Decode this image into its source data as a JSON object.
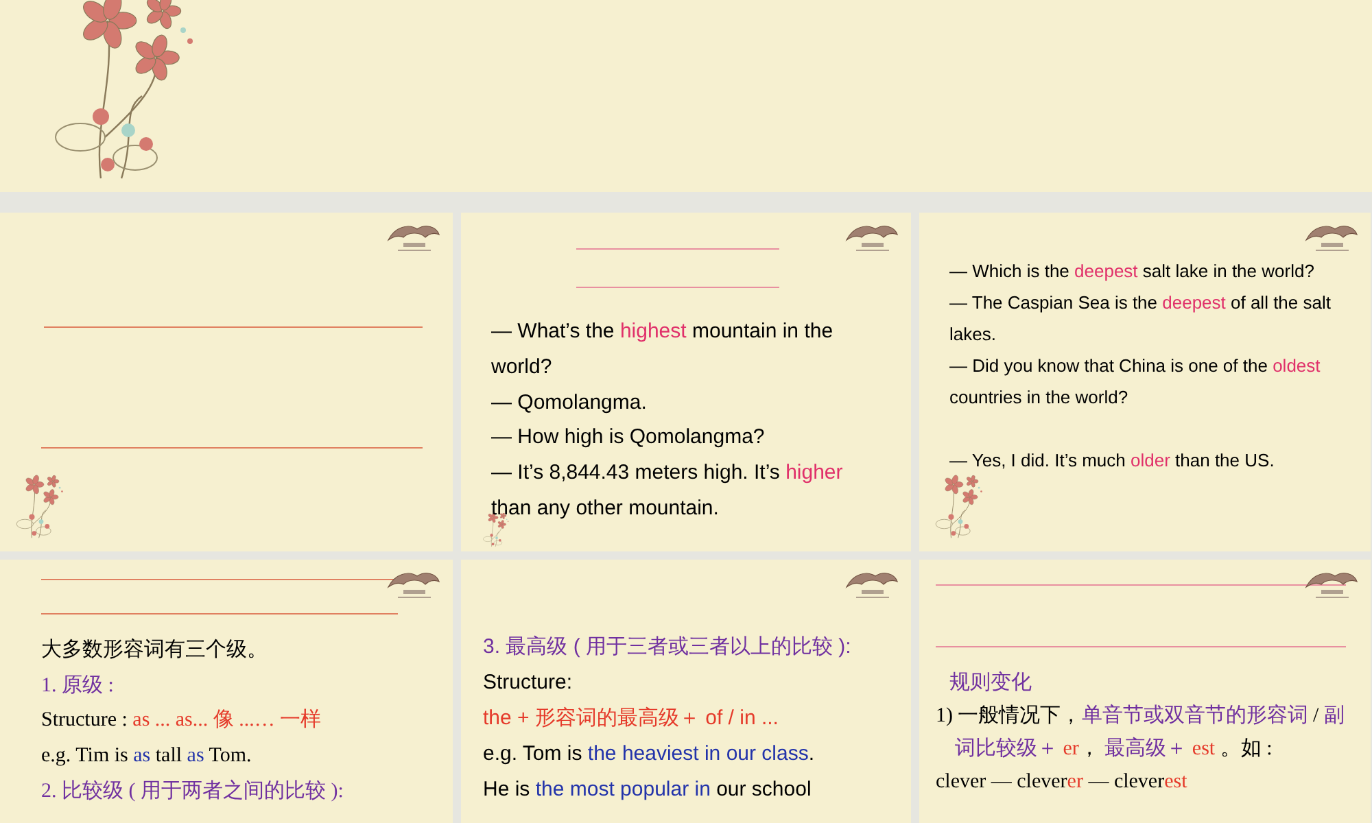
{
  "slides": [
    {
      "items": [
        {
          "kind": "rule",
          "color": "#e08060"
        },
        {
          "kind": "rule",
          "color": "#e08060"
        }
      ]
    },
    {
      "items": [
        {
          "kind": "rule",
          "color": "#e890a0"
        },
        {
          "kind": "rule",
          "color": "#e890a0"
        },
        {
          "kind": "text",
          "parts": [
            {
              "t": "— What’s the "
            },
            {
              "t": "highest",
              "color": "#e0306a"
            },
            {
              "t": " mountain in the world?"
            }
          ]
        },
        {
          "kind": "text",
          "parts": [
            {
              "t": "— Qomolangma."
            }
          ]
        },
        {
          "kind": "text",
          "parts": [
            {
              "t": "— How high is Qomolangma?"
            }
          ]
        },
        {
          "kind": "text",
          "parts": [
            {
              "t": "— It’s 8,844.43 meters high. It’s "
            },
            {
              "t": "higher",
              "color": "#e0306a"
            },
            {
              "t": " than any other mountain."
            }
          ]
        }
      ]
    },
    {
      "items": [
        {
          "kind": "text",
          "parts": [
            {
              "t": "— Which is the "
            },
            {
              "t": "deepest",
              "color": "#e0306a"
            },
            {
              "t": " salt lake in the world?"
            }
          ]
        },
        {
          "kind": "text",
          "parts": [
            {
              "t": "— The Caspian Sea is the "
            },
            {
              "t": "deepest",
              "color": "#e0306a"
            },
            {
              "t": " of all the salt lakes."
            }
          ]
        },
        {
          "kind": "text",
          "parts": [
            {
              "t": "— Did you know that China is one of the "
            },
            {
              "t": "oldest",
              "color": "#e0306a"
            },
            {
              "t": " countries in the world?"
            }
          ]
        },
        {
          "kind": "gap"
        },
        {
          "kind": "text",
          "parts": [
            {
              "t": "— Yes, I did. It’s much "
            },
            {
              "t": "older",
              "color": "#e0306a"
            },
            {
              "t": " than the US."
            }
          ]
        }
      ]
    },
    {
      "items": [
        {
          "kind": "rule",
          "color": "#e08060"
        },
        {
          "kind": "rule",
          "color": "#e08060"
        },
        {
          "kind": "text",
          "parts": [
            {
              "t": "大多数形容词有三个级。"
            }
          ]
        },
        {
          "kind": "text",
          "parts": [
            {
              "t": "1.  原级 :",
              "color": "#7030a0"
            }
          ]
        },
        {
          "kind": "text",
          "parts": [
            {
              "t": "Structure : "
            },
            {
              "t": "as ... as...  像 ...… 一样",
              "color": "#e53a2a"
            }
          ]
        },
        {
          "kind": "text",
          "parts": [
            {
              "t": "e.g. Tim is "
            },
            {
              "t": "as",
              "color": "#2233aa"
            },
            {
              "t": " tall "
            },
            {
              "t": "as",
              "color": "#2233aa"
            },
            {
              "t": " Tom."
            }
          ]
        },
        {
          "kind": "text",
          "parts": [
            {
              "t": "2.  比较级  ( 用于两者之间的比较 ):",
              "color": "#7030a0"
            }
          ]
        }
      ]
    },
    {
      "items": [
        {
          "kind": "text",
          "parts": [
            {
              "t": "3.  最高级 ( 用于三者或三者以上的比较 ):",
              "color": "#7030a0"
            }
          ]
        },
        {
          "kind": "text",
          "parts": [
            {
              "t": "Structure:"
            }
          ]
        },
        {
          "kind": "text",
          "parts": [
            {
              "t": "the +  形容词的最高级＋ of / in ...",
              "color": "#e53a2a"
            }
          ]
        },
        {
          "kind": "text",
          "parts": [
            {
              "t": "e.g. Tom is "
            },
            {
              "t": "the heaviest in our class",
              "color": "#2233aa"
            },
            {
              "t": "."
            }
          ]
        },
        {
          "kind": "text",
          "parts": [
            {
              "t": "He is "
            },
            {
              "t": "the most popular in",
              "color": "#2233aa"
            },
            {
              "t": " our school"
            }
          ]
        }
      ]
    },
    {
      "items": [
        {
          "kind": "rule",
          "color": "#e890a0"
        },
        {
          "kind": "rule",
          "color": "#e890a0"
        },
        {
          "kind": "text",
          "parts": [
            {
              "t": "规则变化",
              "color": "#7030a0"
            }
          ]
        },
        {
          "kind": "hanging",
          "parts": [
            {
              "t": "1)  一般情况下，"
            },
            {
              "t": "单音节或双音节的形容词",
              "color": "#7030a0"
            },
            {
              "t": " / "
            },
            {
              "t": "副词比较级＋ ",
              "color": "#7030a0"
            },
            {
              "t": "er",
              "color": "#e53a2a"
            },
            {
              "t": "，  "
            },
            {
              "t": "最高级＋ ",
              "color": "#7030a0"
            },
            {
              "t": "est",
              "color": "#e53a2a"
            },
            {
              "t": " 。如 :"
            }
          ]
        },
        {
          "kind": "text",
          "parts": [
            {
              "t": "clever — clever"
            },
            {
              "t": "er",
              "color": "#e53a2a"
            },
            {
              "t": " — clever"
            },
            {
              "t": "est",
              "color": "#e53a2a"
            }
          ]
        }
      ]
    }
  ]
}
